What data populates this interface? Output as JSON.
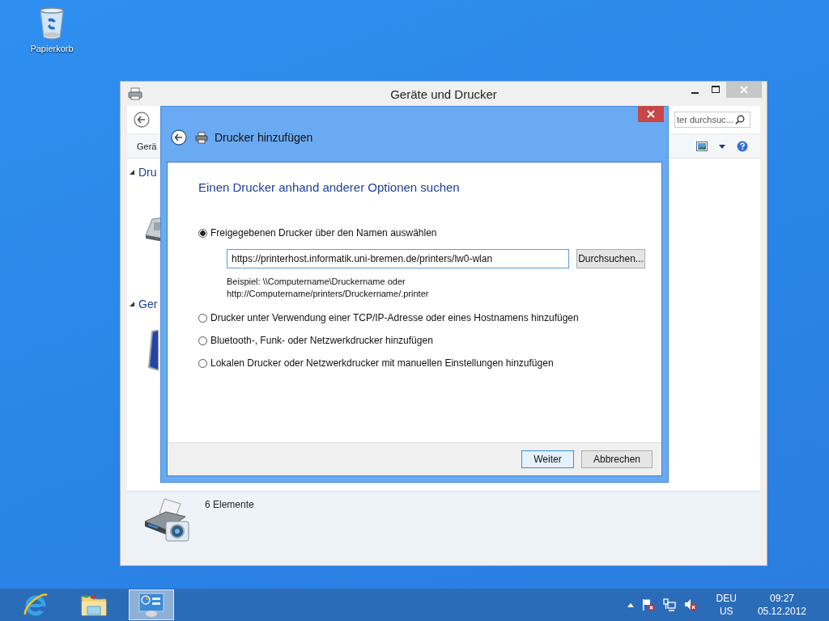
{
  "desktop": {
    "icons": [
      {
        "label": "Papierkorb",
        "kind": "recycle-bin"
      }
    ]
  },
  "background_window": {
    "title": "Geräte und Drucker",
    "search": {
      "placeholder": "ter durchsuc..."
    },
    "toolbar": {
      "label": "Gerä"
    },
    "groups": [
      {
        "label": "Dru",
        "expanded": true
      },
      {
        "label": "Ger",
        "expanded": true
      }
    ],
    "details": {
      "count": "6 Elemente"
    }
  },
  "dialog": {
    "title": "Drucker hinzufügen",
    "heading": "Einen Drucker anhand anderer Optionen suchen",
    "options": [
      {
        "label": "Freigegebenen Drucker über den Namen auswählen",
        "selected": true
      },
      {
        "label": "Drucker unter Verwendung einer TCP/IP-Adresse oder eines Hostnamens hinzufügen",
        "selected": false
      },
      {
        "label": "Bluetooth-, Funk- oder Netzwerkdrucker hinzufügen",
        "selected": false
      },
      {
        "label": "Lokalen Drucker oder Netzwerkdrucker mit manuellen Einstellungen hinzufügen",
        "selected": false
      }
    ],
    "path_field": {
      "value": "https://printerhost.informatik.uni-bremen.de/printers/lw0-wlan"
    },
    "browse_button": "Durchsuchen...",
    "example": [
      "Beispiel: \\\\Computername\\Druckername oder",
      "http://Computername/printers/Druckername/.printer"
    ],
    "buttons": [
      {
        "label": "Weiter",
        "default": true
      },
      {
        "label": "Abbrechen",
        "default": false
      }
    ]
  },
  "taskbar": {
    "apps": [
      {
        "kind": "browser",
        "selected": false
      },
      {
        "kind": "folder",
        "selected": false
      },
      {
        "kind": "control-panel",
        "selected": true
      }
    ],
    "tray": {
      "language": "DEU",
      "layout": "US",
      "time": "09:27",
      "date": "05.12.2012"
    }
  }
}
